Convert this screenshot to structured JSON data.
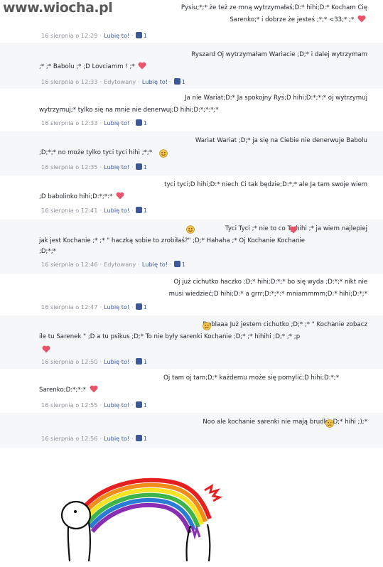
{
  "watermark": {
    "text": "www.wiocha.pl"
  },
  "thread": {
    "comments": [
      {
        "text": "Pysiu;*;* że też ze mną wytrzymałaś;D:* hihi;D:* Kocham Cię",
        "text2": "Sarenko;* i dobrze że jesteś ;*;* <33;*  ;*",
        "time": "16 sierpnia o 12:29",
        "like": "Lubię to!",
        "count": "1",
        "edited": ""
      },
      {
        "text": "Ryszard Oj wytrzymałam Wariacie ;D;* i dalej wytrzymam",
        "text2": ";*  ;* Babolu ;* ;D Lovciamm !  ;*",
        "time": "16 sierpnia o 12:33",
        "like": "Lubię to!",
        "count": "1",
        "edited": "Edytowany"
      },
      {
        "text": "Ja nie Wariat;D:* Ja spokojny Ryś;D hihi;D:*;*:* oj wytrzymuj",
        "text2": "wytrzymuj;* tylko się na mnie nie denerwuj;D hihi;D:*;*:*;*",
        "time": "16 sierpnia o 12:33",
        "like": "Lubię to!",
        "count": "1",
        "edited": ""
      },
      {
        "text": "Wariat Wariat ;D;* ja się na Ciebie nie denerwuje Babolu",
        "text2": ";D;*;* no może tylko tyci tyci  hihi ;*;*",
        "time": "16 sierpnia o 12:35",
        "like": "Lubię to!",
        "count": "1",
        "edited": ""
      },
      {
        "text": "tyci tyci;D hihi;D:* niech Ci tak będzie;D:*;* ale Ja tam swoje wiem",
        "text2": ";D babolinko hihi;D:*;*:*",
        "time": "16 sierpnia o 12:41",
        "like": "Lubię to!",
        "count": "1",
        "edited": ""
      },
      {
        "text": "Tyci Tyci  ;* nie to co Ty hihi ;*  ja wiem najlepiej",
        "text2": "jak jest Kochanie ;* ;* \" haczką sobie to zrobiłaś?\" ;D;* Hahaha ;* Oj Kochanie Kochanie",
        "text3": ";D;*;*",
        "time": "16 sierpnia o 12:46",
        "like": "Lubię to!",
        "count": "1",
        "edited": "Edytowany"
      },
      {
        "text": "Oj już cichutko haczko ;D;* hihi;D:*;* bo się wyda ;D:*;* nikt nie",
        "text2": "musi wiedzieć;D hihi;D:* a grrr;D:*;*:* mniammmm;D:* hihi;D:*;*",
        "time": "16 sierpnia o 12:47",
        "like": "Lubię to!",
        "count": "1",
        "edited": ""
      },
      {
        "text": "Doblaaa  Już jestem cichutko ;D;* ;* \" Kochanie zobacz",
        "text2": "ile tu Sarenek \" ;D a tu psikus ;D;* To nie były sarenki Kochanie ;D;* ;* hihihi ;D;* ;* ;p",
        "time": "16 sierpnia o 12:50",
        "like": "Lubię to!",
        "count": "1",
        "edited": ""
      },
      {
        "text": "Oj tam oj tam;D;* każdemu może się pomylić;D hihi;D:*;*",
        "text2": "Sarenko;D:*;*:*",
        "time": "16 sierpnia o 12:55",
        "like": "Lubię to!",
        "count": "1",
        "edited": ""
      },
      {
        "text": "Noo ale kochanie sarenki nie mają brudki ;D;*  hihi ;);*",
        "time": "16 sierpnia o 12:56",
        "like": "Lubię to!",
        "count": "1",
        "edited": ""
      }
    ]
  },
  "colors": {
    "link": "#3b5998",
    "meta": "#90949c",
    "text": "#1d2129",
    "heart": "#e9546b",
    "smiley": "#f3c14a"
  },
  "icons": [
    "heart-icon",
    "smiley-icon",
    "sad-smiley-icon",
    "thumbs-up-icon"
  ]
}
